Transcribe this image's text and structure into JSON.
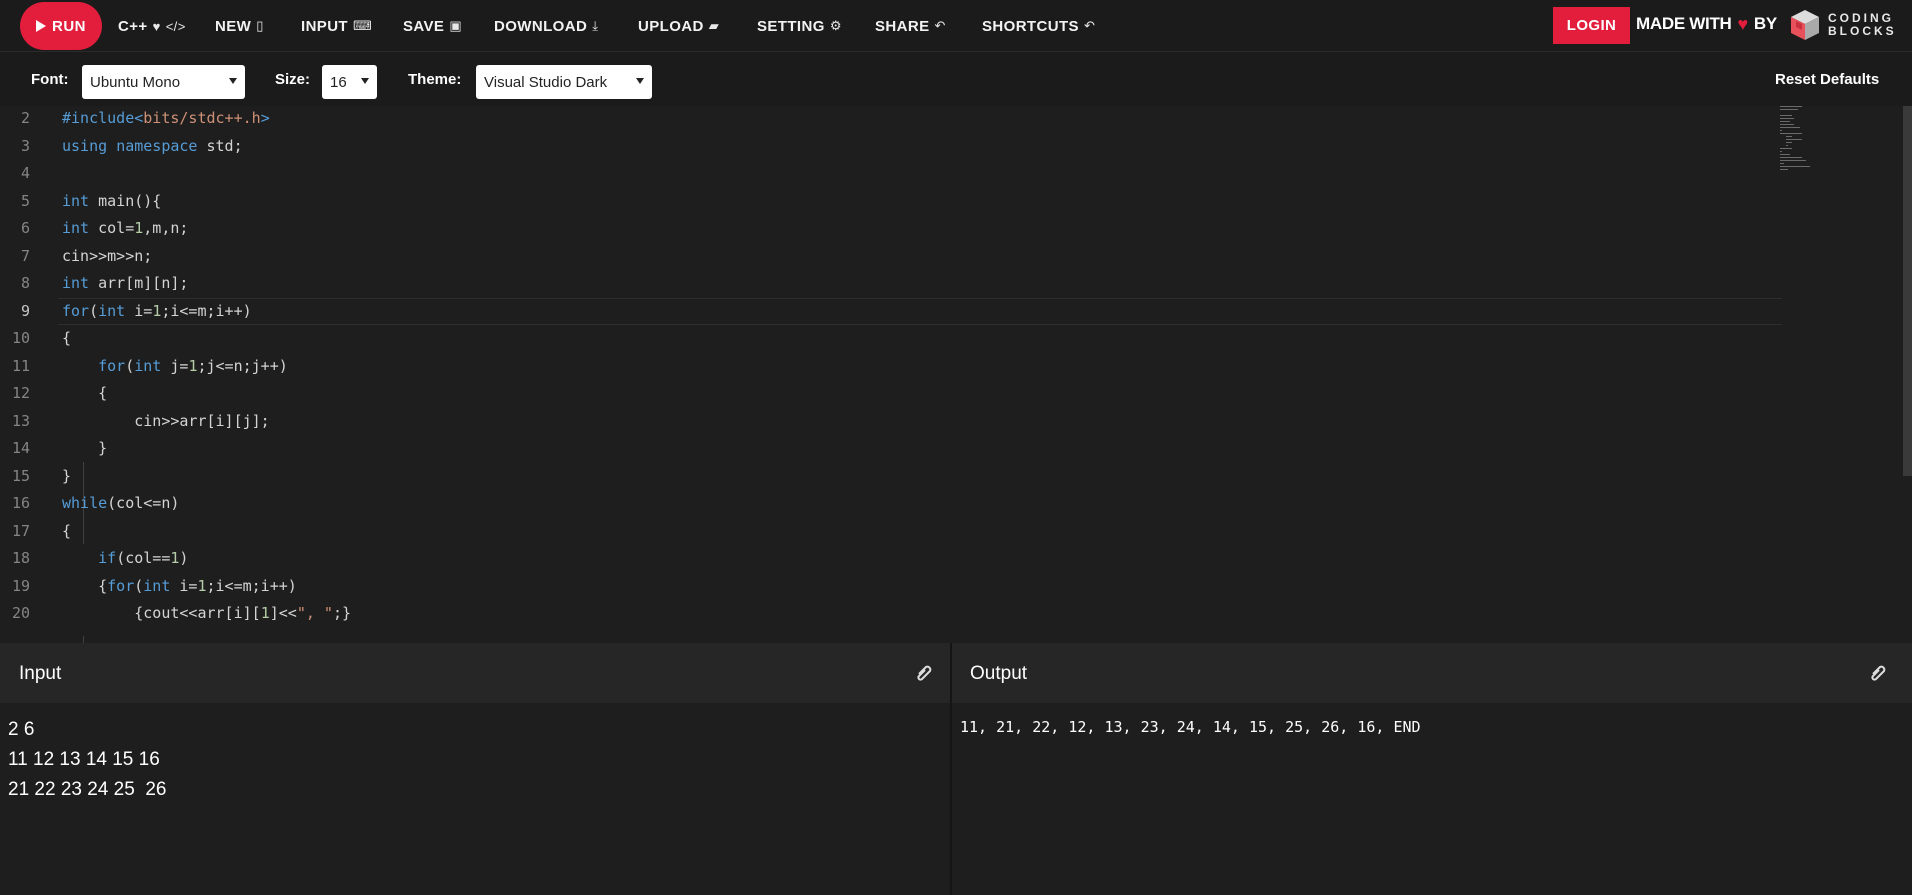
{
  "toolbar": {
    "run_label": "RUN",
    "language": "C++",
    "new_label": "NEW",
    "input_label": "INPUT",
    "save_label": "SAVE",
    "download_label": "DOWNLOAD",
    "upload_label": "UPLOAD",
    "setting_label": "SETTING",
    "share_label": "SHARE",
    "shortcuts_label": "SHORTCUTS",
    "login_label": "LOGIN",
    "made_with": "MADE WITH",
    "by": "BY",
    "brand_line1": "CODING",
    "brand_line2": "BLOCKS"
  },
  "settings": {
    "font_label": "Font:",
    "font_value": "Ubuntu Mono",
    "size_label": "Size:",
    "size_value": "16",
    "theme_label": "Theme:",
    "theme_value": "Visual Studio Dark",
    "reset_label": "Reset Defaults"
  },
  "editor": {
    "active_line": 9,
    "lines": [
      {
        "n": "2",
        "code": "#include<bits/stdc++.h>"
      },
      {
        "n": "3",
        "code": "using namespace std;"
      },
      {
        "n": "4",
        "code": ""
      },
      {
        "n": "5",
        "code": "int main(){"
      },
      {
        "n": "6",
        "code": "int col=1,m,n;"
      },
      {
        "n": "7",
        "code": "cin>>m>>n;"
      },
      {
        "n": "8",
        "code": "int arr[m][n];"
      },
      {
        "n": "9",
        "code": "for(int i=1;i<=m;i++)"
      },
      {
        "n": "10",
        "code": "{"
      },
      {
        "n": "11",
        "code": "    for(int j=1;j<=n;j++)"
      },
      {
        "n": "12",
        "code": "    {"
      },
      {
        "n": "13",
        "code": "        cin>>arr[i][j];"
      },
      {
        "n": "14",
        "code": "    }"
      },
      {
        "n": "15",
        "code": "}"
      },
      {
        "n": "16",
        "code": "while(col<=n)"
      },
      {
        "n": "17",
        "code": "{"
      },
      {
        "n": "18",
        "code": "    if(col==1)"
      },
      {
        "n": "19",
        "code": "    {for(int i=1;i<=m;i++)"
      },
      {
        "n": "20",
        "code": "        {cout<<arr[i][1]<<\", \";}"
      }
    ]
  },
  "input_panel": {
    "title": "Input",
    "text": "2 6\n11 12 13 14 15 16\n21 22 23 24 25  26"
  },
  "output_panel": {
    "title": "Output",
    "text": "11, 21, 22, 12, 13, 23, 24, 14, 15, 25, 26, 16, END"
  },
  "colors": {
    "accent": "#e21e3c",
    "keyword": "#569cd6",
    "number": "#b5cea8",
    "string": "#ce9178",
    "text": "#d4d4d4"
  }
}
